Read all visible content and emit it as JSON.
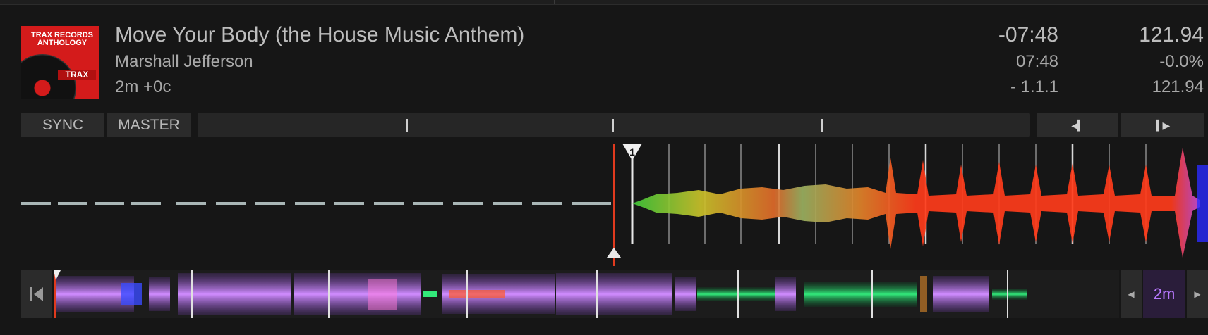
{
  "track": {
    "title": "Move Your Body (the House Music Anthem)",
    "artist": "Marshall Jefferson",
    "key_info": "2m +0c"
  },
  "cover_art": {
    "line1": "TRAX RECORDS",
    "line2": "ANTHOLOGY",
    "badge": "TRAX"
  },
  "time": {
    "remaining": "-07:48",
    "elapsed": "07:48",
    "beat_position": "-  1.1.1"
  },
  "tempo": {
    "bpm": "121.94",
    "pitch": "-0.0%",
    "original_bpm": "121.94"
  },
  "controls": {
    "sync_label": "SYNC",
    "master_label": "MASTER",
    "beatjump_back_icon": "beatjump-back-icon",
    "beatjump_forward_icon": "beatjump-forward-icon"
  },
  "waveform": {
    "cue_number": "1"
  },
  "overview": {
    "jump_to_start_icon": "jump-to-start-icon",
    "zoom_left_icon": "zoom-left-icon",
    "zoom_right_icon": "zoom-right-icon",
    "zoom_value": "2m"
  },
  "colors": {
    "accent_purple": "#b878ff",
    "playhead": "#e03a1e",
    "background": "#161616"
  }
}
